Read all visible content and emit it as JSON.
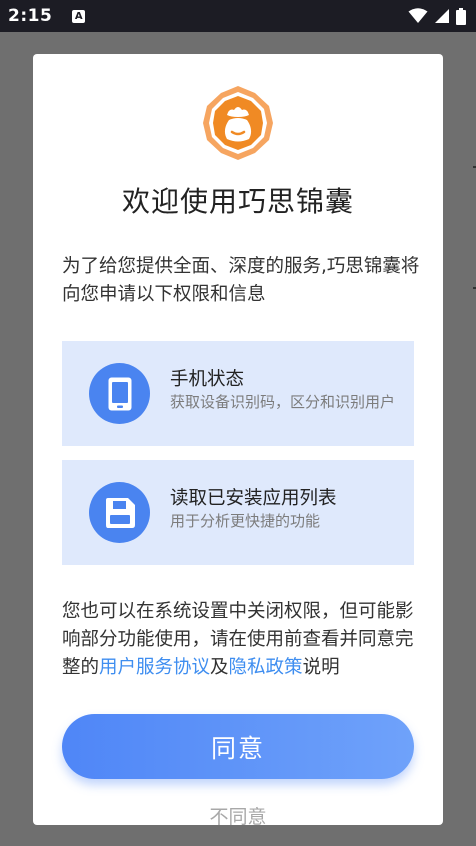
{
  "status_bar": {
    "time": "2:15",
    "notification_letter": "A"
  },
  "dialog": {
    "title": "欢迎使用巧思锦囊",
    "intro": "为了给您提供全面、深度的服务,巧思锦囊将向您申请以下权限和信息",
    "permissions": [
      {
        "title": "手机状态",
        "description": "获取设备识别码，区分和识别用户",
        "icon": "phone-icon"
      },
      {
        "title": "读取已安装应用列表",
        "description": "用于分析更快捷的功能",
        "icon": "save-icon"
      }
    ],
    "notice": {
      "prefix": "您也可以在系统设置中关闭权限，但可能影响部分功能使用，请在使用前查看并同意完整的",
      "link_user_agreement": "用户服务协议",
      "and": "及",
      "link_privacy_policy": "隐私政策",
      "suffix": "说明"
    },
    "agree_label": "同意",
    "disagree_label": "不同意"
  },
  "colors": {
    "accent": "#4f86f7",
    "card_background": "#dfe9fc",
    "link": "#3f8ef0",
    "logo_orange": "#f08a24"
  }
}
